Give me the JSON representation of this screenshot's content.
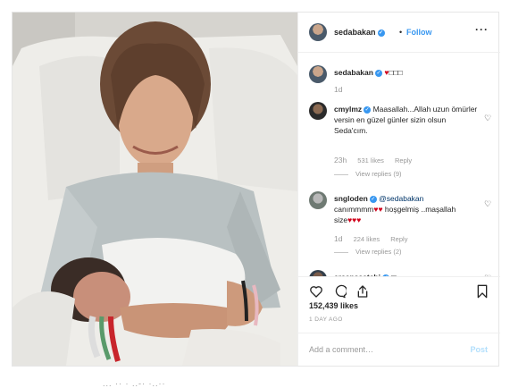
{
  "header": {
    "username": "sedabakan",
    "separator": "•",
    "follow_label": "Follow",
    "more_icon": "more-dots-icon"
  },
  "caption": {
    "username": "sedabakan",
    "hearts": "♥",
    "trail": "□□□",
    "time": "1d"
  },
  "comments": [
    {
      "username": "cmylmz",
      "text": "Maasallah...Allah uzun ömürler versin en güzel günler sizin olsun Seda'cım.",
      "time": "23h",
      "likes": "531 likes",
      "reply": "Reply",
      "view_replies": "View replies (9)"
    },
    {
      "username": "sngloden",
      "text_1": "@sedabakan",
      "text_2": "canımmmm",
      "hearts_1": "♥♥",
      "text_3": "hoşgelmiş ..maşallah size",
      "hearts_2": "♥♥♥",
      "time": "1d",
      "likes": "224 likes",
      "reply": "Reply",
      "view_replies": "View replies (2)"
    },
    {
      "username": "ercansaatchi",
      "text": "□"
    }
  ],
  "actions": {
    "like_icon": "heart-icon",
    "comment_icon": "comment-icon",
    "share_icon": "share-icon",
    "save_icon": "bookmark-icon",
    "likes": "152,439 likes",
    "posted": "1 DAY AGO",
    "add_comment_placeholder": "Add a comment…",
    "post_label": "Post"
  },
  "below_text": "... ·· · ..-· ·..··"
}
